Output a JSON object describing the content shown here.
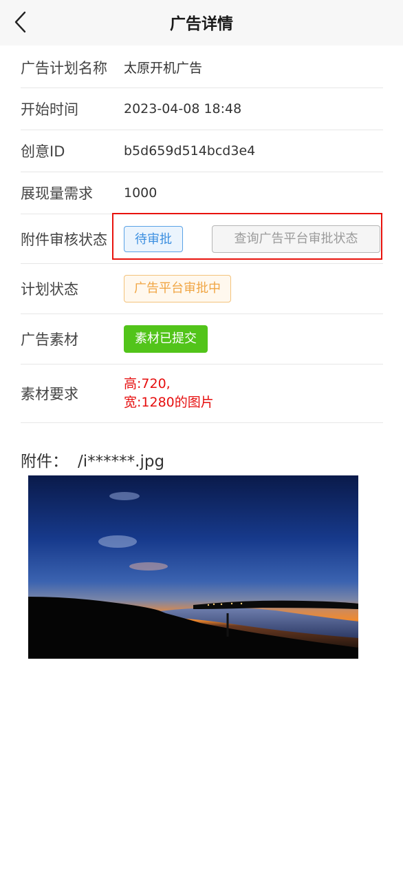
{
  "header": {
    "title": "广告详情",
    "back_icon": "chevron-left-icon"
  },
  "details": {
    "plan_name": {
      "label": "广告计划名称",
      "value": "太原开机广告"
    },
    "start_time": {
      "label": "开始时间",
      "value": "2023-04-08 18:48"
    },
    "creative_id": {
      "label": "创意ID",
      "value": "b5d659d514bcd3e4"
    },
    "impressions": {
      "label": "展现量需求",
      "value": "1000"
    },
    "attachment_status": {
      "label": "附件审核状态",
      "tag": "待审批",
      "query_button": "查询广告平台审批状态"
    },
    "plan_status": {
      "label": "计划状态",
      "tag": "广告平台审批中"
    },
    "material": {
      "label": "广告素材",
      "button": "素材已提交"
    },
    "material_req": {
      "label": "素材要求",
      "line1": "高:720,",
      "line2": "宽:1280的图片"
    }
  },
  "attachment": {
    "label": "附件：",
    "filename": "/i******.jpg"
  },
  "colors": {
    "accent_blue": "#3c8fe0",
    "warning_orange": "#f0a543",
    "success_green": "#52c41a",
    "danger_red": "#e60e0e",
    "highlight_red": "#e8120c"
  }
}
